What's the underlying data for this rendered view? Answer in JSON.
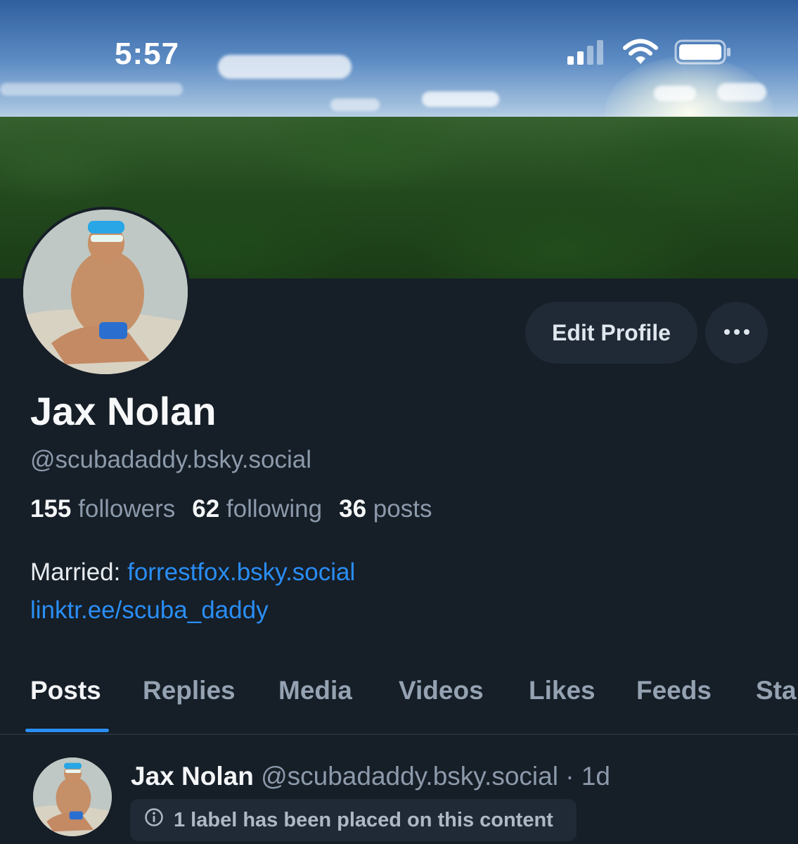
{
  "status_bar": {
    "time": "5:57"
  },
  "profile": {
    "display_name": "Jax Nolan",
    "handle": "@scubadaddy.bsky.social",
    "edit_label": "Edit Profile",
    "stats": [
      {
        "value": "155",
        "label": "followers"
      },
      {
        "value": "62",
        "label": "following"
      },
      {
        "value": "36",
        "label": "posts"
      }
    ],
    "bio": {
      "married_prefix": "Married:",
      "married_link": "forrestfox.bsky.social",
      "link": "linktr.ee/scuba_daddy"
    }
  },
  "tabs": [
    "Posts",
    "Replies",
    "Media",
    "Videos",
    "Likes",
    "Feeds",
    "Sta"
  ],
  "active_tab": "Posts",
  "post": {
    "name": "Jax Nolan",
    "handle": "@scubadaddy.bsky.social",
    "separator": "·",
    "time": "1d",
    "label_notice": "1 label has been placed on this content"
  },
  "colors": {
    "accent": "#2a8ef5",
    "background": "#161e27",
    "button_bg": "#1f2a36",
    "muted_text": "#8c9aab"
  }
}
